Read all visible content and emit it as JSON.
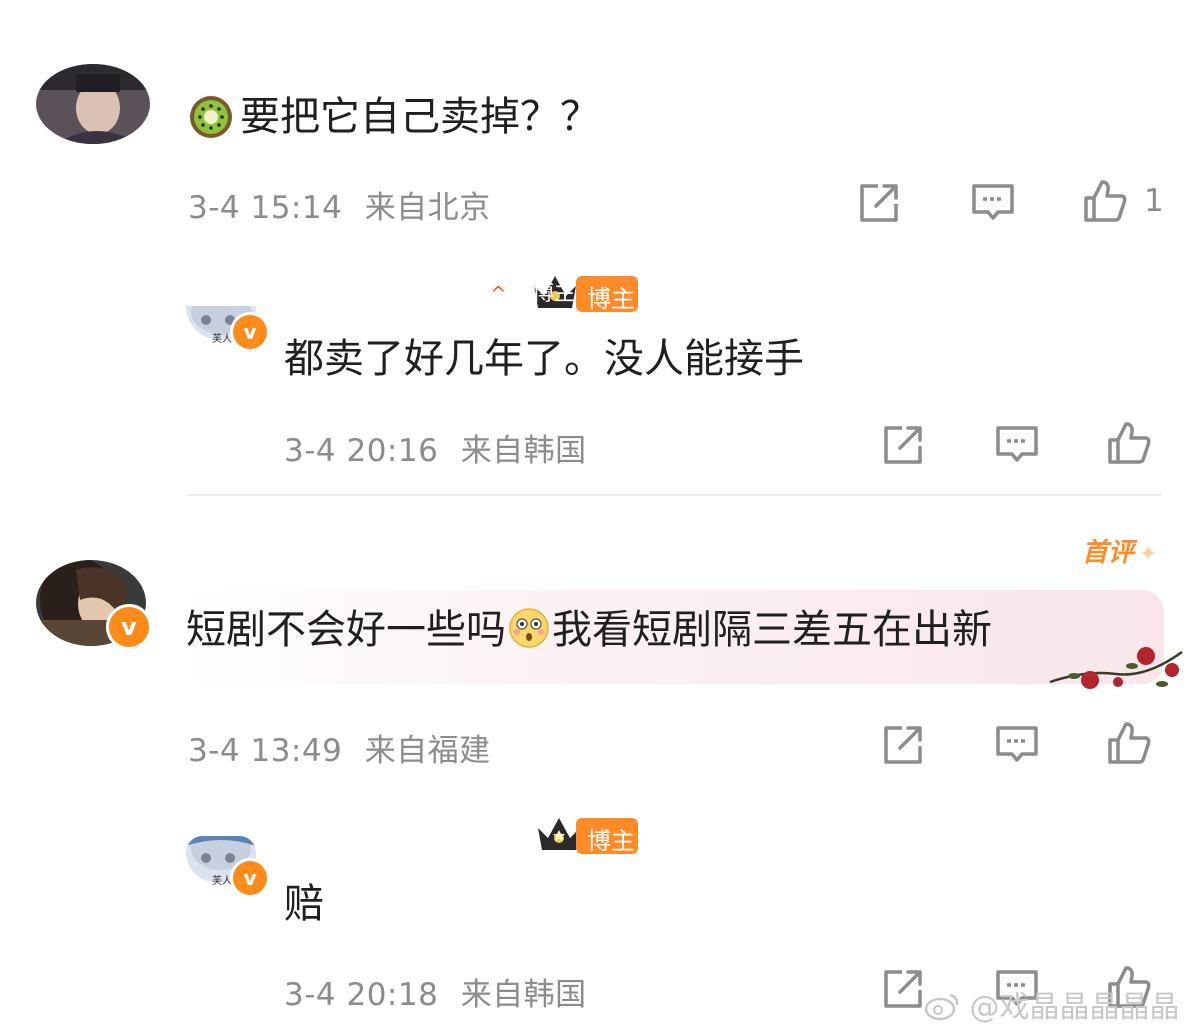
{
  "comments": [
    {
      "text": "要把它自己卖掉？？",
      "emoji": "kiwi-emoji",
      "time": "3-4 15:14",
      "location": "来自北京",
      "likes": "1"
    },
    {
      "badge": "博主",
      "text": "都卖了好几年了。没人能接手",
      "time": "3-4 20:16",
      "location": "来自韩国"
    },
    {
      "tag": "首评",
      "text_before": "短剧不会好一些吗",
      "emoji": "flushed-emoji",
      "text_after": "我看短剧隔三差五在出新",
      "time": "3-4 13:49",
      "location": "来自福建"
    },
    {
      "badge": "博主",
      "text": "赔",
      "time": "3-4 20:18",
      "location": "来自韩国"
    }
  ],
  "verified_mark": "v",
  "avatar_label": "芙人",
  "watermark": "@戏晶晶晶晶晶",
  "colors": {
    "accent": "#ff8a28",
    "meta_text": "#8c8c8c",
    "icon": "#8c8c8c"
  },
  "icons": [
    "share-icon",
    "comment-icon",
    "like-icon"
  ]
}
